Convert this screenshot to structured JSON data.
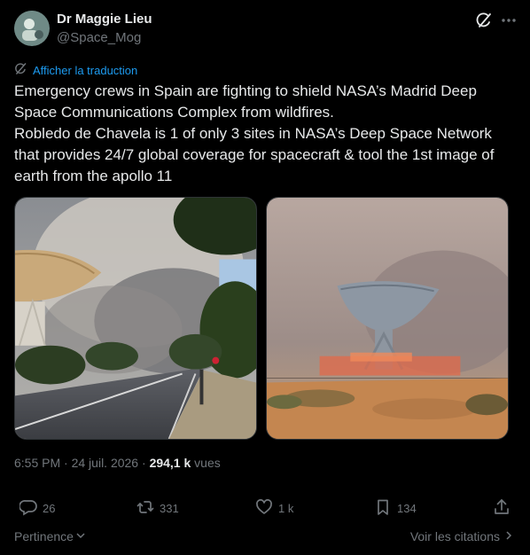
{
  "author": {
    "name": "Dr Maggie Lieu",
    "handle": "@Space_Mog"
  },
  "translate": {
    "label": "Afficher la traduction"
  },
  "tweet": {
    "text": "Emergency crews in Spain are fighting to shield NASA’s Madrid Deep Space Communications Complex from wildfires.\nRobledo de Chavela is 1 of only 3 sites in NASA’s Deep Space Network that provides 24/7 global coverage for spacecraft & tool the 1st image of earth from the apollo 11"
  },
  "meta": {
    "time": "6:55 PM",
    "date": "24 juil. 2026",
    "views_count": "294,1 k",
    "views_label": "vues",
    "sep": "·"
  },
  "actions": {
    "replies": "26",
    "reposts": "331",
    "likes": "1 k",
    "bookmarks": "134"
  },
  "footer": {
    "relevance": "Pertinence",
    "quotes": "Voir les citations"
  },
  "icons": [
    "grok-icon",
    "more-icon",
    "translate-icon",
    "reply-icon",
    "repost-icon",
    "like-icon",
    "bookmark-icon",
    "share-icon",
    "chevron-down-icon",
    "chevron-right-icon"
  ],
  "colors": {
    "background": "#000000",
    "text": "#e7e9ea",
    "muted": "#71767b",
    "accent": "#1d9bf0"
  }
}
